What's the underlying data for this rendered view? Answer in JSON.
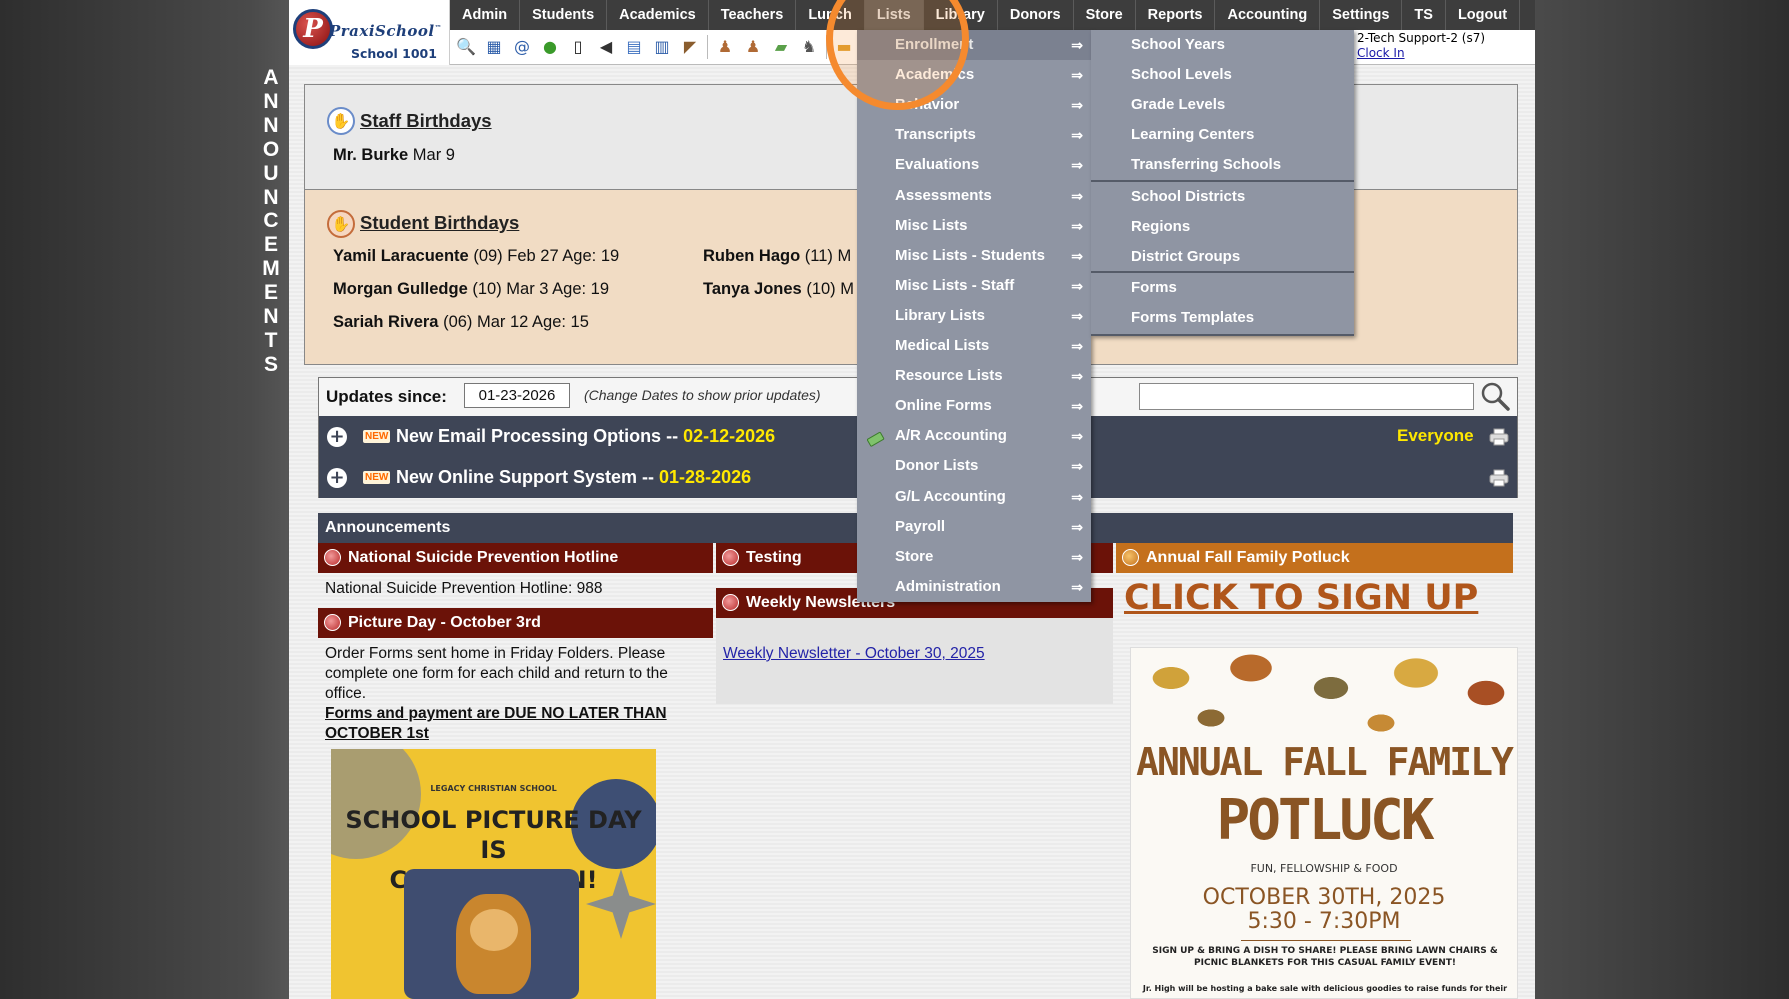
{
  "app": {
    "brand": "PraxiSchool",
    "trademark": "™",
    "school": "School 1001"
  },
  "side_banner": [
    "A",
    "N",
    "N",
    "O",
    "U",
    "N",
    "C",
    "E",
    "M",
    "E",
    "N",
    "T",
    "S"
  ],
  "menu": [
    {
      "label": "Admin"
    },
    {
      "label": "Students"
    },
    {
      "label": "Academics"
    },
    {
      "label": "Teachers"
    },
    {
      "label": "Lunch"
    },
    {
      "label": "Lists"
    },
    {
      "label": "Library"
    },
    {
      "label": "Donors"
    },
    {
      "label": "Store"
    },
    {
      "label": "Reports"
    },
    {
      "label": "Accounting"
    },
    {
      "label": "Settings"
    },
    {
      "label": "TS"
    },
    {
      "label": "Logout"
    }
  ],
  "toolbar_icons": [
    "search-icon",
    "calendar-grid-icon",
    "email-at-icon",
    "chat-icon",
    "phone-icon",
    "speaker-icon",
    "report-icon",
    "schedule-icon",
    "megaphone-icon",
    "user-add-icon",
    "user-icon",
    "money-icon",
    "users-icon",
    "notes-icon"
  ],
  "user": {
    "name": "2-Tech Support-2 (s7)",
    "clock_in": "Clock In"
  },
  "staff_birthdays": {
    "title": "Staff Birthdays",
    "people": [
      {
        "name": "Mr. Burke",
        "detail": "Mar 9"
      }
    ]
  },
  "student_birthdays": {
    "title": "Student Birthdays",
    "people": [
      {
        "name": "Yamil Laracuente",
        "detail": "(09) Feb 27 Age: 19"
      },
      {
        "name": "Morgan Gulledge",
        "detail": "(10) Mar 3 Age: 19"
      },
      {
        "name": "Sariah Rivera",
        "detail": "(06) Mar 12 Age: 15"
      },
      {
        "name": "Ruben Hago",
        "detail": "(11) M"
      },
      {
        "name": "Tanya Jones",
        "detail": "(10) M"
      }
    ]
  },
  "updates": {
    "label": "Updates since:",
    "date": "01-23-2026",
    "hint": "(Change Dates to show prior updates)",
    "search_value": "",
    "rows": [
      {
        "badge": "NEW",
        "title": "New Email Processing Options -- ",
        "date": "02-12-2026",
        "audience": "Everyone"
      },
      {
        "badge": "NEW",
        "title": "New Online Support System -- ",
        "date": "01-28-2026",
        "audience": ""
      }
    ]
  },
  "announcements": {
    "header": "Announcements",
    "col1": [
      {
        "title": "National Suicide Prevention Hotline",
        "body": "National Suicide Prevention Hotline: 988"
      },
      {
        "title": "Picture Day - October 3rd",
        "body": "Order Forms sent home in Friday Folders. Please complete one form for each child and return to the office.",
        "emphasis": "Forms and payment are DUE NO LATER THAN OCTOBER 1st"
      }
    ],
    "col2": [
      {
        "title": "Testing"
      },
      {
        "title": "Weekly Newsletters",
        "link": "Weekly Newsletter - October 30, 2025"
      }
    ],
    "col3": [
      {
        "title": "Annual Fall Family Potluck",
        "link": "CLICK TO SIGN UP"
      }
    ]
  },
  "picture_day_flyer": {
    "school": "LEGACY CHRISTIAN SCHOOL",
    "title_line1": "SCHOOL PICTURE DAY IS",
    "title_line2": "COMING SOON!"
  },
  "potluck_flyer": {
    "title1": "ANNUAL FALL FAMILY",
    "title2": "POTLUCK",
    "tagline": "FUN, FELLOWSHIP & FOOD",
    "date_line": "OCTOBER 30TH, 2025",
    "time_line": "5:30 - 7:30PM",
    "note": "SIGN UP & BRING A DISH TO SHARE! PLEASE BRING LAWN CHAIRS & PICNIC BLANKETS FOR THIS CASUAL FAMILY EVENT!",
    "note2": "Jr. High will be hosting a bake sale with delicious goodies to raise funds for their"
  },
  "lists_menu": [
    {
      "label": "Enrollment",
      "highlighted": true
    },
    {
      "label": "Academics"
    },
    {
      "label": "Behavior"
    },
    {
      "label": "Transcripts"
    },
    {
      "label": "Evaluations"
    },
    {
      "label": "Assessments"
    },
    {
      "label": "Misc Lists"
    },
    {
      "label": "Misc Lists - Students"
    },
    {
      "label": "Misc Lists - Staff"
    },
    {
      "label": "Library Lists"
    },
    {
      "label": "Medical Lists"
    },
    {
      "label": "Resource Lists"
    },
    {
      "label": "Online Forms"
    },
    {
      "label": "A/R Accounting",
      "icon": "money-icon"
    },
    {
      "label": "Donor Lists"
    },
    {
      "label": "G/L Accounting"
    },
    {
      "label": "Payroll"
    },
    {
      "label": "Store"
    },
    {
      "label": "Administration"
    }
  ],
  "arrow_glyph": "⇒",
  "enrollment_submenu": [
    {
      "label": "School Years"
    },
    {
      "label": "School Levels"
    },
    {
      "label": "Grade Levels"
    },
    {
      "label": "Learning Centers"
    },
    {
      "label": "Transferring Schools"
    },
    {
      "label": "School Districts"
    },
    {
      "label": "Regions"
    },
    {
      "label": "District Groups"
    },
    {
      "label": "Forms"
    },
    {
      "label": "Forms Templates"
    }
  ],
  "colors": {
    "menubar": "#3d3d3d",
    "dropdown": "#8f95a3",
    "announcement_title": "#6b1208",
    "potluck_title": "#c4701c",
    "update_row": "#3e4556",
    "highlight_ring": "#f58a2e",
    "date_accent": "#ffe800"
  }
}
